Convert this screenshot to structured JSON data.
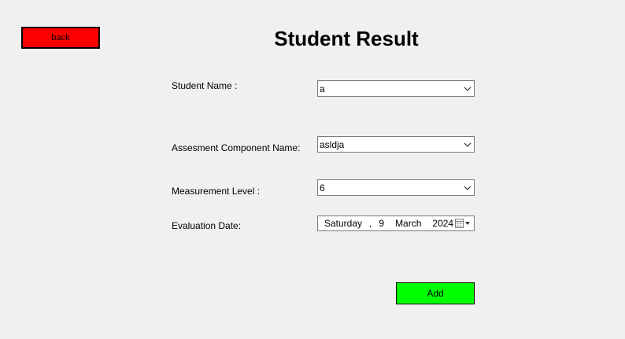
{
  "window": {
    "title": "Student Result"
  },
  "toolbar": {
    "back_label": "back",
    "back_color": "#ff0000"
  },
  "form": {
    "student_name": {
      "label": "Student Name :",
      "value": "a"
    },
    "assessment_component": {
      "label": "Assesment Component Name:",
      "value": "asldja"
    },
    "measurement_level": {
      "label": "Measurement Level :",
      "value": "6"
    },
    "evaluation_date": {
      "label": "Evaluation Date:",
      "weekday": "Saturday",
      "separator": ",",
      "day": "9",
      "month": "March",
      "year": "2024"
    },
    "add_label": "Add",
    "add_color": "#00ff00"
  },
  "icons": {
    "dropdown": "chevron-down-icon",
    "calendar": "calendar-icon"
  }
}
